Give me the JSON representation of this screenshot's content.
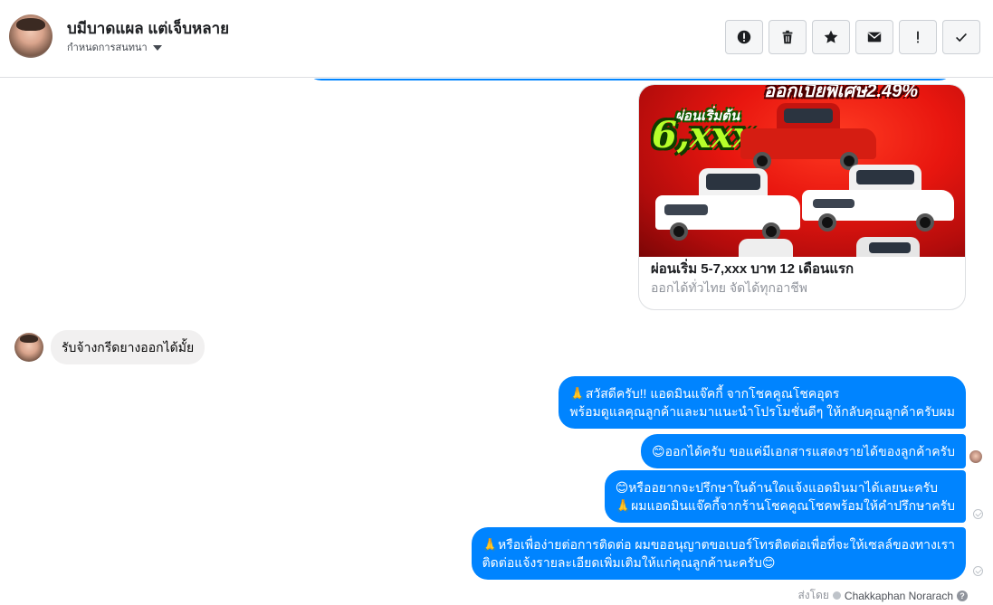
{
  "header": {
    "contact_name": "บมีบาดแผล แต่เจ็บหลาย",
    "assign_label": "กำหนดการสนทนา",
    "actions": [
      {
        "icon": "alert-circle-icon",
        "tooltip": ""
      },
      {
        "icon": "trash-icon",
        "tooltip": ""
      },
      {
        "icon": "star-icon",
        "tooltip": ""
      },
      {
        "icon": "envelope-icon",
        "tooltip": ""
      },
      {
        "icon": "exclamation-icon",
        "tooltip": ""
      },
      {
        "icon": "checkmark-icon",
        "tooltip": ""
      }
    ]
  },
  "card": {
    "image_headline": "ออกเบี้ยพิเศษ2.49%",
    "image_promo_small": "ผ่อนเริ่มต้น",
    "image_promo_big": "6,xxx",
    "title": "ผ่อนเริ่ม 5-7,xxx บาท 12 เดือนแรก",
    "description": "ออกได้ทั่วไทย จัดได้ทุกอาชีพ"
  },
  "incoming": {
    "text": "รับจ้างกรีดยางออกได้มั้ย"
  },
  "outgoing": [
    {
      "lines": [
        "🙏สวัสดีครับ!! แอดมินแจ๊คกี้ จากโชคคูณโชคอุดร",
        "พร้อมดูแลคุณลูกค้าและมาแนะนำโปรโมชั่นดีๆ ให้กลับคุณลูกค้าครับผม"
      ]
    },
    {
      "lines": [
        "😊ออกได้ครับ ขอแค่มีเอกสารแสดงรายได้ของลูกค้าครับ"
      ]
    },
    {
      "lines": [
        "😊หรืออยากจะปรึกษาในด้านใดแจ้งแอดมินมาได้เลยนะครับ",
        "🙏ผมแอดมินแจ๊คกี้จากร้านโชคคูณโชคพร้อมให้คำปรึกษาครับ"
      ]
    },
    {
      "lines": [
        "🙏หรือเพื่อง่ายต่อการติดต่อ ผมขออนุญาตขอเบอร์โทรติดต่อเพื่อที่จะให้เซลล์ของทางเรา",
        "ติดต่อแจ้งรายละเอียดเพิ่มเติมให้แก่คุณลูกค้านะครับ😊"
      ]
    }
  ],
  "footer": {
    "sent_by_label": "ส่งโดย",
    "sender_name": "Chakkaphan Norarach",
    "help_glyph": "?"
  },
  "colors": {
    "outgoing_bubble": "#0084ff",
    "incoming_bubble": "#f1f0f0"
  }
}
